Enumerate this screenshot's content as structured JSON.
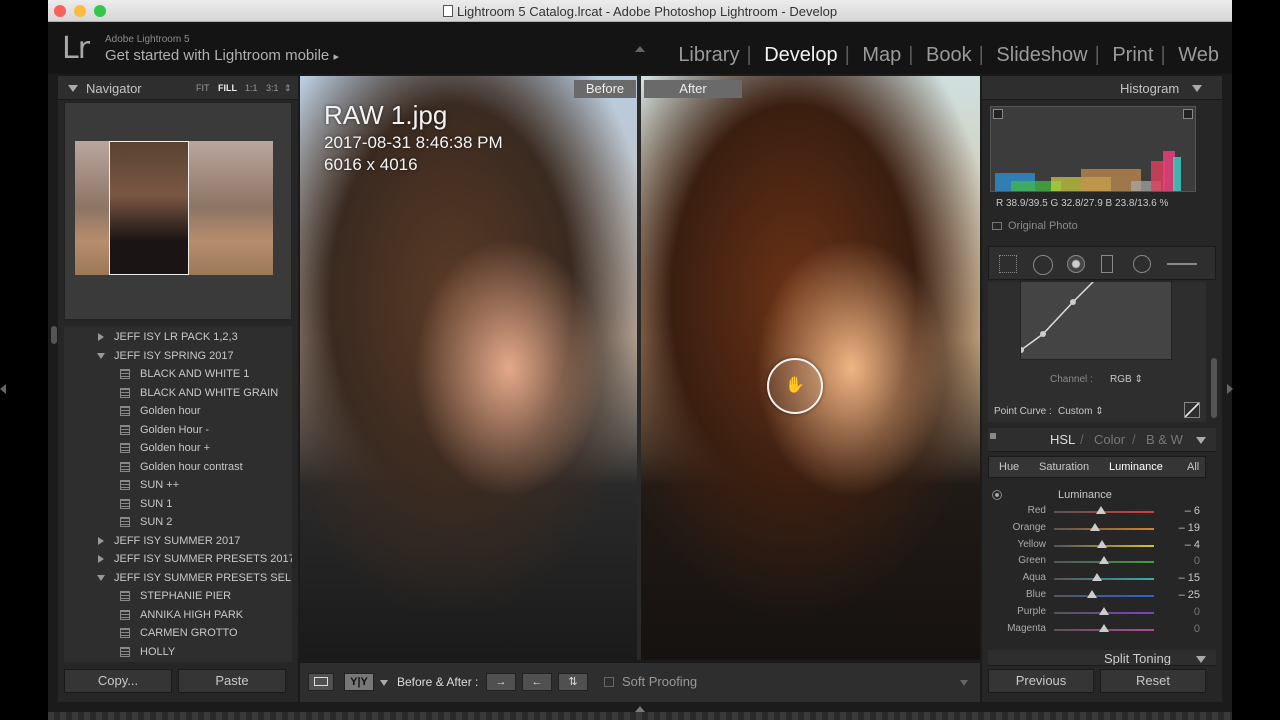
{
  "window": {
    "title": "Lightroom 5 Catalog.lrcat - Adobe Photoshop Lightroom - Develop"
  },
  "identity": {
    "logo": "Lr",
    "small": "Adobe Lightroom 5",
    "main": "Get started with Lightroom mobile",
    "arrow": "▸"
  },
  "modules": [
    "Library",
    "Develop",
    "Map",
    "Book",
    "Slideshow",
    "Print",
    "Web"
  ],
  "active_module": "Develop",
  "navigator": {
    "title": "Navigator",
    "options": [
      "FIT",
      "FILL",
      "1:1",
      "3:1"
    ],
    "selected_option": "FILL"
  },
  "presets": {
    "items": [
      {
        "label": "JEFF ISY LR PACK 1,2,3",
        "type": "folder-closed"
      },
      {
        "label": "JEFF ISY SPRING 2017",
        "type": "folder-open"
      },
      {
        "label": "BLACK AND WHITE 1",
        "type": "preset"
      },
      {
        "label": "BLACK AND WHITE GRAIN",
        "type": "preset"
      },
      {
        "label": "Golden hour",
        "type": "preset"
      },
      {
        "label": "Golden Hour -",
        "type": "preset"
      },
      {
        "label": "Golden hour +",
        "type": "preset"
      },
      {
        "label": "Golden hour contrast",
        "type": "preset"
      },
      {
        "label": "SUN ++",
        "type": "preset"
      },
      {
        "label": "SUN 1",
        "type": "preset"
      },
      {
        "label": "SUN 2",
        "type": "preset"
      },
      {
        "label": "JEFF ISY SUMMER 2017",
        "type": "folder-closed"
      },
      {
        "label": "JEFF ISY SUMMER PRESETS 2017",
        "type": "folder-closed"
      },
      {
        "label": "JEFF ISY SUMMER PRESETS SEL...",
        "type": "folder-open"
      },
      {
        "label": "STEPHANIE PIER",
        "type": "preset"
      },
      {
        "label": "ANNIKA HIGH PARK",
        "type": "preset"
      },
      {
        "label": "CARMEN GROTTO",
        "type": "preset"
      },
      {
        "label": "HOLLY",
        "type": "preset"
      }
    ]
  },
  "left_buttons": {
    "copy": "Copy...",
    "paste": "Paste"
  },
  "image": {
    "filename": "RAW 1.jpg",
    "datetime": "2017-08-31 8:46:38 PM",
    "dimensions": "6016 x 4016",
    "before_label": "Before",
    "after_label": "After",
    "cursor_icon": "hand-icon"
  },
  "toolbar": {
    "view_yy": "Y|Y",
    "before_after_label": "Before & After :",
    "soft_proofing": "Soft Proofing"
  },
  "histogram": {
    "title": "Histogram",
    "r": "38.9/39.5",
    "g": "32.8/27.9",
    "b": "23.8/13.6",
    "unit": "%",
    "original_photo": "Original Photo"
  },
  "tone_curve": {
    "channel_label": "Channel :",
    "channel_value": "RGB",
    "point_curve_label": "Point Curve :",
    "point_curve_value": "Custom"
  },
  "hsl": {
    "header_hsl": "HSL",
    "header_color": "Color",
    "header_bw": "B & W",
    "slash": "/",
    "tabs": [
      "Hue",
      "Saturation",
      "Luminance",
      "All"
    ],
    "active_tab": "Luminance",
    "section_title": "Luminance",
    "sliders": [
      {
        "label": "Red",
        "value": "– 6",
        "num": -6,
        "color": "#d04040"
      },
      {
        "label": "Orange",
        "value": "– 19",
        "num": -19,
        "color": "#d88030"
      },
      {
        "label": "Yellow",
        "value": "– 4",
        "num": -4,
        "color": "#d8c030"
      },
      {
        "label": "Green",
        "value": "0",
        "num": 0,
        "color": "#40a040"
      },
      {
        "label": "Aqua",
        "value": "– 15",
        "num": -15,
        "color": "#30b0b0"
      },
      {
        "label": "Blue",
        "value": "– 25",
        "num": -25,
        "color": "#3060d0"
      },
      {
        "label": "Purple",
        "value": "0",
        "num": 0,
        "color": "#8040c0"
      },
      {
        "label": "Magenta",
        "value": "0",
        "num": 0,
        "color": "#c040a0"
      }
    ]
  },
  "split_toning": {
    "title": "Split Toning"
  },
  "right_buttons": {
    "previous": "Previous",
    "reset": "Reset"
  }
}
